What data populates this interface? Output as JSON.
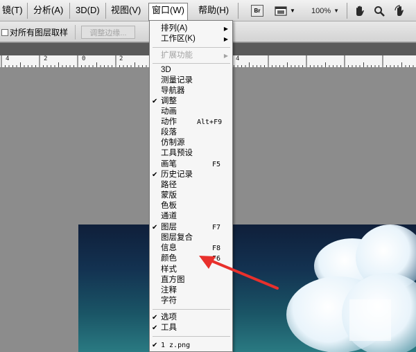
{
  "menubar": {
    "items": [
      {
        "label": "镜(T)"
      },
      {
        "label": "分析(A)"
      },
      {
        "label": "3D(D)"
      },
      {
        "label": "视图(V)"
      },
      {
        "label": "窗口(W)"
      },
      {
        "label": "帮助(H)"
      }
    ],
    "br_label": "Br",
    "zoom_value": "100%",
    "icons": [
      "bridge-icon",
      "screen-mode-icon",
      "hand-tool-icon",
      "zoom-tool-icon",
      "rotate-view-icon"
    ]
  },
  "options": {
    "sample_all_layers": "对所有图层取样",
    "refine_edge": "调整边缘..."
  },
  "ruler": {
    "labels": [
      "4",
      "2",
      "0",
      "2",
      "4"
    ]
  },
  "window_menu": {
    "items": [
      {
        "label": "排列(A)",
        "check": "",
        "shortcut": "",
        "submenu": "▶"
      },
      {
        "label": "工作区(K)",
        "check": "",
        "shortcut": "",
        "submenu": "▶"
      },
      {
        "label": "扩展功能",
        "check": "",
        "shortcut": "",
        "submenu": "▶"
      },
      {
        "label": "3D",
        "check": "",
        "shortcut": ""
      },
      {
        "label": "测量记录",
        "check": "",
        "shortcut": ""
      },
      {
        "label": "导航器",
        "check": "",
        "shortcut": ""
      },
      {
        "label": "调整",
        "check": "✔",
        "shortcut": ""
      },
      {
        "label": "动画",
        "check": "",
        "shortcut": ""
      },
      {
        "label": "动作",
        "check": "",
        "shortcut": "Alt+F9"
      },
      {
        "label": "段落",
        "check": "",
        "shortcut": ""
      },
      {
        "label": "仿制源",
        "check": "",
        "shortcut": ""
      },
      {
        "label": "工具预设",
        "check": "",
        "shortcut": ""
      },
      {
        "label": "画笔",
        "check": "",
        "shortcut": "F5"
      },
      {
        "label": "历史记录",
        "check": "✔",
        "shortcut": ""
      },
      {
        "label": "路径",
        "check": "",
        "shortcut": ""
      },
      {
        "label": "蒙版",
        "check": "",
        "shortcut": ""
      },
      {
        "label": "色板",
        "check": "",
        "shortcut": ""
      },
      {
        "label": "通道",
        "check": "",
        "shortcut": ""
      },
      {
        "label": "图层",
        "check": "✔",
        "shortcut": "F7"
      },
      {
        "label": "图层复合",
        "check": "",
        "shortcut": ""
      },
      {
        "label": "信息",
        "check": "",
        "shortcut": "F8"
      },
      {
        "label": "颜色",
        "check": "",
        "shortcut": "F6"
      },
      {
        "label": "样式",
        "check": "",
        "shortcut": ""
      },
      {
        "label": "直方图",
        "check": "",
        "shortcut": ""
      },
      {
        "label": "注释",
        "check": "",
        "shortcut": ""
      },
      {
        "label": "字符",
        "check": "",
        "shortcut": ""
      },
      {
        "label": "选项",
        "check": "✔",
        "shortcut": ""
      },
      {
        "label": "工具",
        "check": "✔",
        "shortcut": ""
      },
      {
        "label": "1 z.png",
        "check": "✔",
        "shortcut": ""
      }
    ]
  },
  "colors": {
    "annotation_arrow": "#e8302c",
    "menu_background": "#f6f6f6",
    "canvas_background": "#8c8c8c"
  }
}
